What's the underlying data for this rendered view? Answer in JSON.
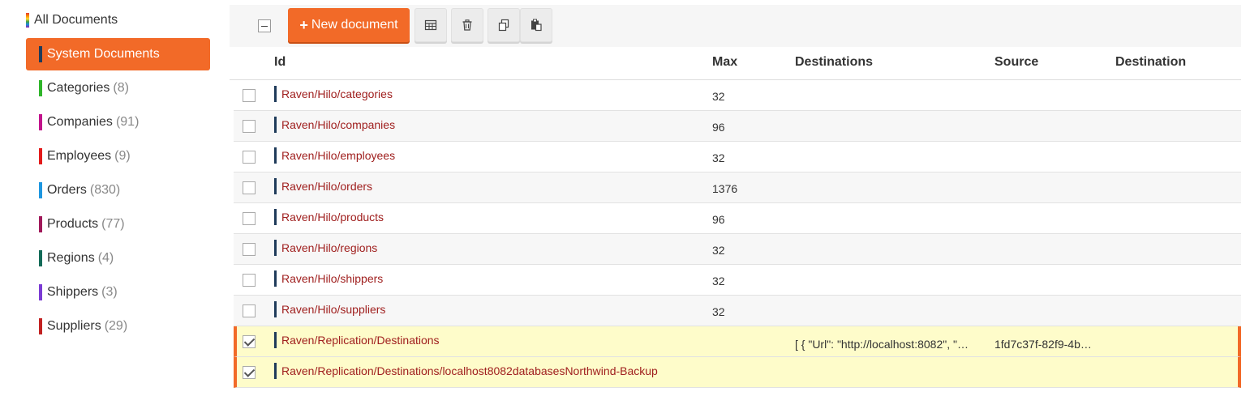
{
  "sidebar": {
    "all_documents": "All Documents",
    "items": [
      {
        "label": "System Documents",
        "count": "",
        "color": "#1f3b5a",
        "active": true
      },
      {
        "label": "Categories",
        "count": "(8)",
        "color": "#2fb52a"
      },
      {
        "label": "Companies",
        "count": "(91)",
        "color": "#c2138c"
      },
      {
        "label": "Employees",
        "count": "(9)",
        "color": "#e31b1b"
      },
      {
        "label": "Orders",
        "count": "(830)",
        "color": "#1e97e0"
      },
      {
        "label": "Products",
        "count": "(77)",
        "color": "#a0195a"
      },
      {
        "label": "Regions",
        "count": "(4)",
        "color": "#136b58"
      },
      {
        "label": "Shippers",
        "count": "(3)",
        "color": "#7b3bd4"
      },
      {
        "label": "Suppliers",
        "count": "(29)",
        "color": "#c22222"
      }
    ]
  },
  "toolbar": {
    "new_document_label": "New document",
    "icons": [
      "table-icon",
      "trash-icon",
      "copy-icon",
      "paste-icon"
    ]
  },
  "table": {
    "columns": [
      "Id",
      "Max",
      "Destinations",
      "Source",
      "Destination"
    ],
    "rows": [
      {
        "id": "Raven/Hilo/categories",
        "max": "32",
        "destinations": "",
        "source": "",
        "checked": false
      },
      {
        "id": "Raven/Hilo/companies",
        "max": "96",
        "destinations": "",
        "source": "",
        "checked": false
      },
      {
        "id": "Raven/Hilo/employees",
        "max": "32",
        "destinations": "",
        "source": "",
        "checked": false
      },
      {
        "id": "Raven/Hilo/orders",
        "max": "1376",
        "destinations": "",
        "source": "",
        "checked": false
      },
      {
        "id": "Raven/Hilo/products",
        "max": "96",
        "destinations": "",
        "source": "",
        "checked": false
      },
      {
        "id": "Raven/Hilo/regions",
        "max": "32",
        "destinations": "",
        "source": "",
        "checked": false
      },
      {
        "id": "Raven/Hilo/shippers",
        "max": "32",
        "destinations": "",
        "source": "",
        "checked": false
      },
      {
        "id": "Raven/Hilo/suppliers",
        "max": "32",
        "destinations": "",
        "source": "",
        "checked": false
      },
      {
        "id": "Raven/Replication/Destinations",
        "max": "",
        "destinations": "[ { \"Url\": \"http://localhost:8082\", \"…",
        "source": "1fd7c37f-82f9-4b…",
        "checked": true
      },
      {
        "id": "Raven/Replication/Destinations/localhost8082databasesNorthwind-Backup",
        "max": "",
        "destinations": "",
        "source": "",
        "checked": true
      }
    ]
  },
  "colors": {
    "accent": "#f26a28",
    "link": "#a0201f",
    "selected_row": "#fefcca"
  }
}
